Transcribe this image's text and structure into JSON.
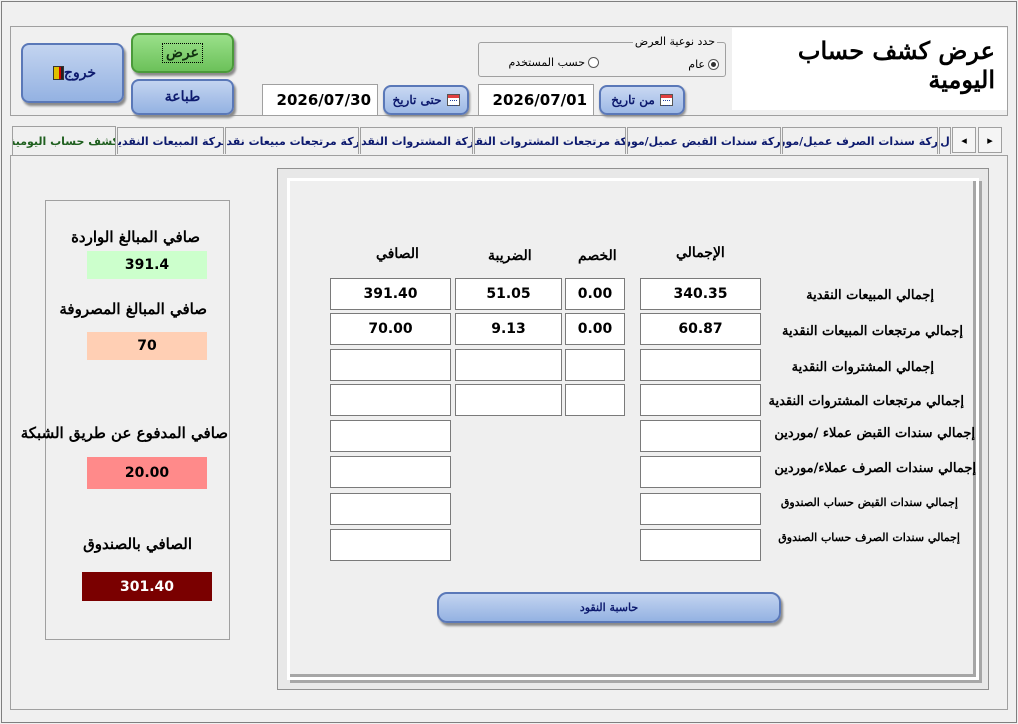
{
  "header": {
    "title": "عرض كشف حساب اليومية",
    "buttons": {
      "exit": "خروج",
      "view": "عرض",
      "print": "طباعة"
    },
    "date_from_label": "من تاريخ",
    "date_from_value": "2026/07/01",
    "date_to_label": "حتى تاريخ",
    "date_to_value": "2026/07/30",
    "view_type": {
      "legend": "حدد نوعية العرض",
      "option_general": "عام",
      "option_user": "حسب المستخدم",
      "selected": "عام"
    }
  },
  "tabs": [
    "كشف حساب اليومية",
    "حركة المبيعات النقدية",
    "حركة مرتجعات مبيعات نقدية",
    "حركة المشتروات النقدية",
    "حركة مرتجعات المشتروات النقدية",
    "حركة سندات القبض عميل/مورد",
    "حركة سندات الصرف عميل/مورد",
    "ل"
  ],
  "active_tab": "كشف حساب اليومية",
  "summary": {
    "incoming_label": "صافي المبالغ الواردة",
    "incoming_value": "391.4",
    "incoming_color": "#ccffcc",
    "spent_label": "صافي المبالغ المصروفة",
    "spent_value": "70",
    "spent_color": "#ffcfb4",
    "network_label": "صافي المدفوع عن طريق الشبكة",
    "network_value": "20.00",
    "network_color": "#ff8a8a",
    "cashbox_label": "الصافي بالصندوق",
    "cashbox_value": "301.40",
    "cashbox_color": "#7a0000"
  },
  "table": {
    "headers": {
      "total": "الإجمالي",
      "discount": "الخصم",
      "tax": "الضريبة",
      "net": "الصافي"
    },
    "rows": [
      {
        "label": "إجمالي المبيعات النقدية",
        "total": "340.35",
        "discount": "0.00",
        "tax": "51.05",
        "net": "391.40"
      },
      {
        "label": "إجمالي مرتجعات المبيعات النقدية",
        "total": "60.87",
        "discount": "0.00",
        "tax": "9.13",
        "net": "70.00"
      },
      {
        "label": "إجمالي المشتروات النقدية",
        "total": "",
        "discount": "",
        "tax": "",
        "net": ""
      },
      {
        "label": "إجمالي مرتجعات المشتروات النقدية",
        "total": "",
        "discount": "",
        "tax": "",
        "net": ""
      },
      {
        "label": "إجمالي سندات القبض عملاء /موردين",
        "total": "",
        "net": ""
      },
      {
        "label": "إجمالي سندات الصرف  عملاء/موردين",
        "total": "",
        "net": ""
      },
      {
        "label": "إجمالي سندات القبض حساب الصندوق",
        "total": "",
        "net": ""
      },
      {
        "label": "إجمالي سندات الصرف  حساب الصندوق",
        "total": "",
        "net": ""
      }
    ]
  },
  "calculator_button": "حاسبة النقود"
}
